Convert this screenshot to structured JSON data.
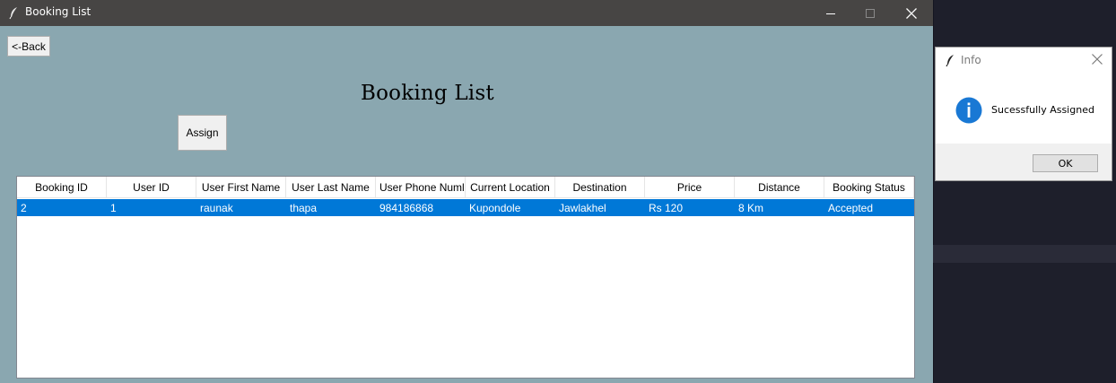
{
  "window": {
    "title": "Booking List",
    "icon": "feather-icon"
  },
  "back_button_label": "<-Back",
  "page_title": "Booking List",
  "assign_button_label": "Assign",
  "table": {
    "columns": [
      "Booking ID",
      "User ID",
      "User First Name",
      "User Last Name",
      "User Phone Numl",
      "Current Location",
      "Destination",
      "Price",
      "Distance",
      "Booking Status"
    ],
    "rows": [
      [
        "2",
        "1",
        "raunak",
        "thapa",
        "984186868",
        "Kupondole",
        "Jawlakhel",
        "Rs 120",
        "8 Km",
        "Accepted"
      ]
    ],
    "selected_row": 0
  },
  "info_dialog": {
    "title": "Info",
    "message": "Sucessfully Assigned",
    "ok_label": "OK",
    "icon": "info-icon"
  },
  "colors": {
    "window_bg": "#8aa7b0",
    "titlebar_bg": "#474544",
    "selection": "#0078d7",
    "desktop_bg": "#1e1f2b"
  }
}
